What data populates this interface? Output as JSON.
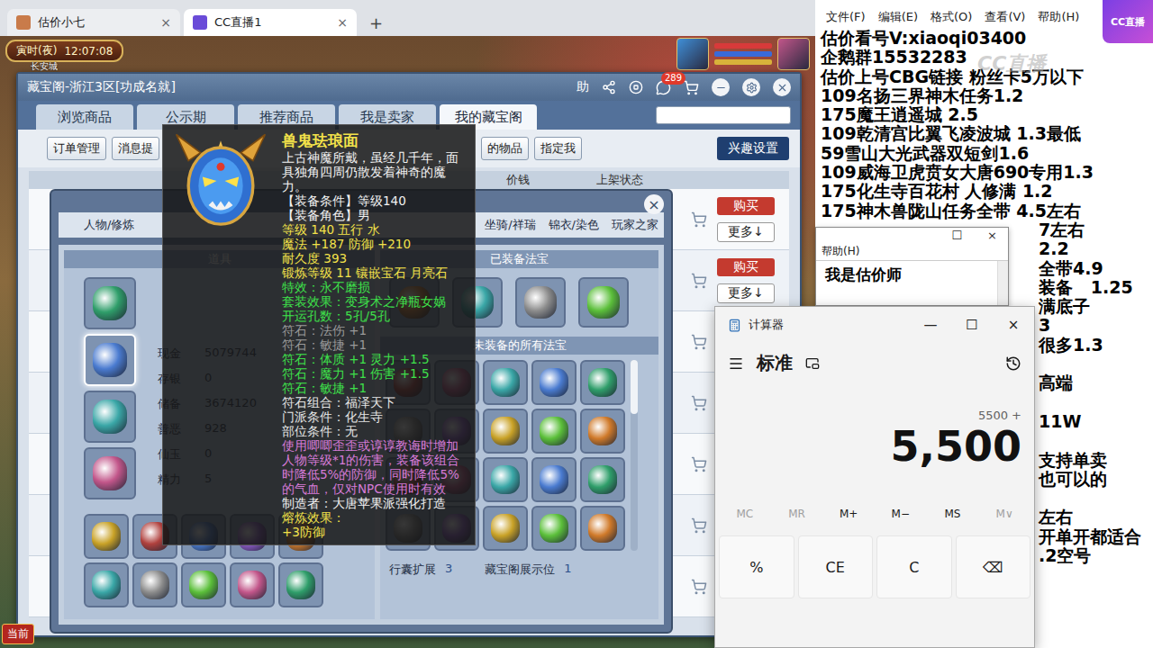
{
  "browser": {
    "tabs": [
      {
        "label": "估价小七",
        "selected": false
      },
      {
        "label": "CC直播1",
        "selected": true
      }
    ],
    "close": "×",
    "new_tab": "+"
  },
  "hud": {
    "period": "寅时(夜)",
    "time": "12:07:08",
    "location": "长安城",
    "current": "当前"
  },
  "cbg": {
    "title": "藏宝阁-浙江3区[功成名就]",
    "help": "助",
    "messages": "289",
    "tabs": [
      {
        "label": "浏览商品",
        "selected": false
      },
      {
        "label": "公示期",
        "selected": false
      },
      {
        "label": "推荐商品",
        "selected": false
      },
      {
        "label": "我是卖家",
        "selected": false
      },
      {
        "label": "我的藏宝阁",
        "selected": true
      }
    ],
    "tools_left": [
      "订单管理",
      "消息提"
    ],
    "tools_mid": [
      "的物品",
      "指定我"
    ],
    "interest": "兴趣设置",
    "columns": [
      "价钱",
      "上架状态"
    ],
    "listings": [
      {
        "buy": "购买",
        "more": "更多↓"
      },
      {
        "buy": "购买",
        "more": "更多↓"
      }
    ]
  },
  "dialog": {
    "close": "×",
    "tabs": [
      {
        "label": "人物/修炼",
        "selected": false
      },
      {
        "label": "坐骑/祥瑞",
        "selected": false
      },
      {
        "label": "锦衣/染色",
        "selected": false
      },
      {
        "label": "玩家之家",
        "selected": false
      }
    ],
    "items_header": "道具",
    "equipped_header": "已装备法宝",
    "unequipped_header": "未装备的所有法宝",
    "equip_slots": [
      {
        "selected": false
      },
      {
        "selected": true
      },
      {
        "selected": false
      },
      {
        "selected": false
      }
    ],
    "stats": [
      {
        "label": "现金",
        "value": "5079744"
      },
      {
        "label": "存银",
        "value": "0"
      },
      {
        "label": "储备",
        "value": "3674120"
      },
      {
        "label": "善恶",
        "value": "928"
      },
      {
        "label": "仙玉",
        "value": "0"
      },
      {
        "label": "精力",
        "value": "5"
      }
    ],
    "footer": [
      {
        "label": "行囊扩展",
        "value": "3"
      },
      {
        "label": "藏宝阁展示位",
        "value": "1"
      }
    ]
  },
  "tooltip": {
    "name": "兽鬼珐琅面",
    "description": "上古神魔所戴，虽经几千年，面具独角四周仍散发着神奇的魔力。",
    "lines": [
      {
        "text": "【装备条件】等级140",
        "color": "#f2f2f2"
      },
      {
        "text": "【装备角色】男",
        "color": "#f2f2f2"
      },
      {
        "text": "等级 140  五行 水",
        "color": "#f3e24a"
      },
      {
        "text": "魔法 +187 防御 +210",
        "color": "#f3e24a"
      },
      {
        "text": "耐久度 393",
        "color": "#f3e24a"
      },
      {
        "text": "锻炼等级 11  镶嵌宝石 月亮石",
        "color": "#f3e24a"
      },
      {
        "text": "特效：永不磨损",
        "color": "#3ee04a"
      },
      {
        "text": "套装效果：变身术之净瓶女娲",
        "color": "#3ee04a"
      },
      {
        "text": "开运孔数：5孔/5孔",
        "color": "#3ee04a"
      },
      {
        "text": "符石：法伤 +1",
        "color": "#9a9a9a"
      },
      {
        "text": "符石：敏捷 +1",
        "color": "#9a9a9a"
      },
      {
        "text": "符石：体质 +1 灵力 +1.5",
        "color": "#3ee04a"
      },
      {
        "text": "符石：魔力 +1 伤害 +1.5",
        "color": "#3ee04a"
      },
      {
        "text": "符石：敏捷 +1",
        "color": "#3ee04a"
      },
      {
        "text": "符石组合：福泽天下",
        "color": "#e6e6e6"
      },
      {
        "text": "门派条件：化生寺",
        "color": "#e6e6e6"
      },
      {
        "text": "部位条件：无",
        "color": "#e6e6e6"
      },
      {
        "text": "使用唧唧歪歪或谆谆教诲时增加人物等级*1的伤害，装备该组合时降低5%的防御，同时降低5%的气血，仅对NPC使用时有效",
        "color": "#d77bd8"
      },
      {
        "text": "制造者：大唐苹果派强化打造",
        "color": "#f2f2f2"
      },
      {
        "text": "熔炼效果：",
        "color": "#f3e24a"
      },
      {
        "text": "+3防御",
        "color": "#f3e24a"
      }
    ]
  },
  "notepad": {
    "menu": [
      "文件(F)",
      "编辑(E)",
      "格式(O)",
      "查看(V)",
      "帮助(H)"
    ],
    "lines": [
      {
        "text": "估价看号V:xiaoqi03400",
        "kind": "full"
      },
      {
        "text": "企鹅群15532283",
        "kind": "full"
      },
      {
        "text": "估价上号CBG链接 粉丝卡5万以下",
        "kind": "full"
      },
      {
        "text": "109名扬三界神木任务1.2",
        "kind": "full"
      },
      {
        "text": "175魔王逍遥城 2.5",
        "kind": "full"
      },
      {
        "text": "109乾清宫比翼飞凌波城 1.3最低",
        "kind": "full"
      },
      {
        "text": "59雪山大光武器双短剑1.6",
        "kind": "full"
      },
      {
        "text": "109威海卫虎贲女大唐690专用1.3",
        "kind": "full"
      },
      {
        "text": "175化生寺百花村 人修满 1.2",
        "kind": "full"
      },
      {
        "text": "175神木兽陇山任务全带 4.5左右",
        "kind": "full"
      },
      {
        "text": "7左右",
        "kind": "tail"
      },
      {
        "text": "2.2",
        "kind": "tail"
      },
      {
        "text": "全带4.9",
        "kind": "tail"
      },
      {
        "text": "装备   1.25",
        "kind": "tail"
      },
      {
        "text": "满底子",
        "kind": "tail"
      },
      {
        "text": "3",
        "kind": "tail"
      },
      {
        "text": "很多1.3",
        "kind": "tail"
      },
      {
        "kind": "blank"
      },
      {
        "text": "高端",
        "kind": "tail"
      },
      {
        "kind": "blank"
      },
      {
        "text": "11W",
        "kind": "tail"
      },
      {
        "kind": "blank"
      },
      {
        "text": "支持单卖",
        "kind": "tail"
      },
      {
        "text": "也可以的",
        "kind": "tail"
      },
      {
        "kind": "blank"
      },
      {
        "text": "左右",
        "kind": "tail"
      },
      {
        "text": "开单开都适合",
        "kind": "tail"
      },
      {
        "text": ".2空号",
        "kind": "tail"
      }
    ]
  },
  "small_window": {
    "controls": [
      "☐",
      "×"
    ],
    "menu": "帮助(H)",
    "text": "我是估价师"
  },
  "calculator": {
    "title": "计算器",
    "controls": [
      "—",
      "☐",
      "×"
    ],
    "mode": "标准",
    "expression": "5500 +",
    "value": "5,500",
    "memory": [
      {
        "label": "MC",
        "disabled": true
      },
      {
        "label": "MR",
        "disabled": true
      },
      {
        "label": "M+",
        "disabled": false
      },
      {
        "label": "M−",
        "disabled": false
      },
      {
        "label": "MS",
        "disabled": false
      },
      {
        "label": "M∨",
        "disabled": true
      }
    ],
    "keys": [
      "%",
      "CE",
      "C",
      "⌫"
    ]
  },
  "logo": "CC直播",
  "watermark": "CC直播"
}
